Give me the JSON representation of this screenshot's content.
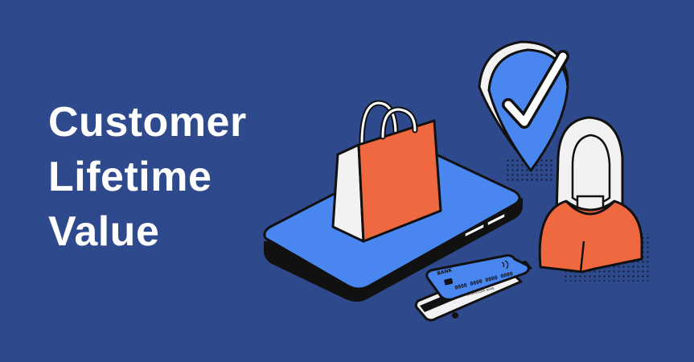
{
  "banner": {
    "title_lines": [
      "Customer",
      "Lifetime",
      "Value"
    ]
  },
  "card_front": {
    "bank_label": "BANK",
    "number": "0000 0000 0000 0000",
    "holder": "CARDHOLDER NAME"
  },
  "colors": {
    "background": "#2f4a8c",
    "phone_screen": "#4a86f0",
    "bag": "#f0683f",
    "shield": "#4a86f0",
    "person_shirt": "#f0683f",
    "outline": "#111111"
  },
  "icons": [
    "smartphone-icon",
    "shopping-bag-icon",
    "check-shield-icon",
    "person-icon",
    "credit-card-icon"
  ]
}
